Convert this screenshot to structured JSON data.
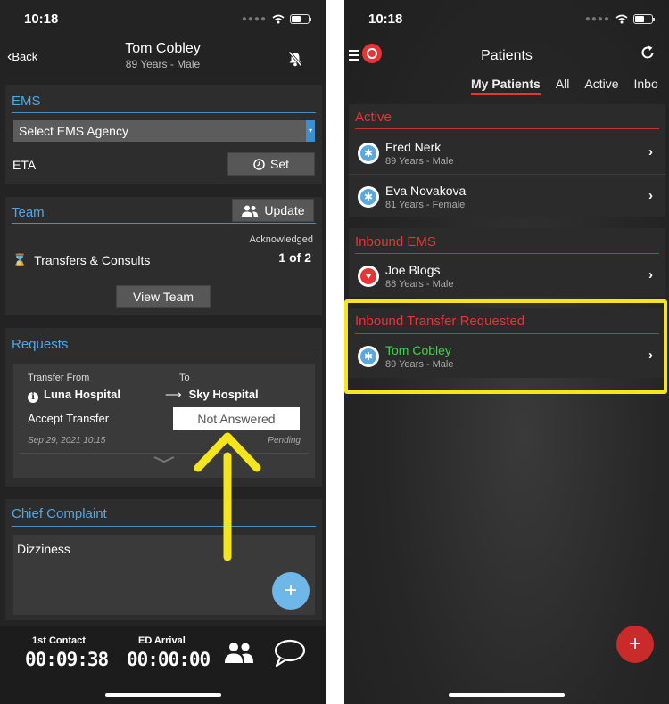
{
  "left": {
    "status": {
      "time": "10:18"
    },
    "nav": {
      "back_label": "Back",
      "patient_name": "Tom Cobley",
      "patient_sub": "89 Years - Male"
    },
    "ems": {
      "title": "EMS",
      "agency_select": "Select EMS Agency",
      "eta_label": "ETA",
      "set_button": "Set"
    },
    "team": {
      "title": "Team",
      "update_button": "Update",
      "acknowledged_label": "Acknowledged",
      "transfers_label": "Transfers & Consults",
      "count": "1 of 2",
      "view_team_button": "View Team"
    },
    "requests": {
      "title": "Requests",
      "from_label": "Transfer From",
      "to_label": "To",
      "from_hospital": "Luna Hospital",
      "to_hospital": "Sky Hospital",
      "accept_label": "Accept Transfer",
      "status_value": "Not Answered",
      "date": "Sep 29, 2021 10:15",
      "pending": "Pending"
    },
    "complaint": {
      "title": "Chief Complaint",
      "text": "Dizziness"
    },
    "timers": {
      "first_contact_label": "1st Contact",
      "first_contact_value": "00:09:38",
      "ed_arrival_label": "ED Arrival",
      "ed_arrival_value": "00:00:00"
    }
  },
  "right": {
    "status": {
      "time": "10:18"
    },
    "title": "Patients",
    "tabs": [
      "My Patients",
      "All",
      "Active",
      "Inbo"
    ],
    "active_tab": "My Patients",
    "sections": {
      "active": {
        "title": "Active",
        "patients": [
          {
            "name": "Fred Nerk",
            "sub": "89 Years - Male"
          },
          {
            "name": "Eva Novakova",
            "sub": "81 Years - Female"
          }
        ]
      },
      "inbound_ems": {
        "title": "Inbound EMS",
        "patients": [
          {
            "name": "Joe Blogs",
            "sub": "88 Years - Male"
          }
        ]
      },
      "inbound_transfer": {
        "title": "Inbound Transfer Requested",
        "patients": [
          {
            "name": "Tom Cobley",
            "sub": "89 Years - Male"
          }
        ]
      }
    }
  },
  "colors": {
    "accent_blue": "#4ea8e6",
    "accent_red": "#e53535",
    "highlight_yellow": "#f5e51b",
    "name_green": "#3fd14c",
    "fab_blue": "#6fb7e8",
    "fab_red": "#c92b2b"
  },
  "icons": [
    "back-chevron-icon",
    "bell-muted-icon",
    "clock-icon",
    "people-icon",
    "hourglass-icon",
    "info-icon",
    "arrow-right-icon",
    "chevron-down-icon",
    "plus-icon",
    "team-icon",
    "chat-icon",
    "menu-icon",
    "logo-icon",
    "refresh-icon",
    "star-of-life-icon",
    "heart-icon",
    "chevron-right-icon"
  ]
}
